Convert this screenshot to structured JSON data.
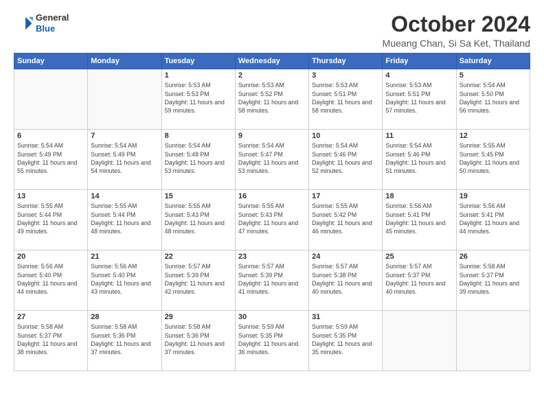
{
  "logo": {
    "line1": "General",
    "line2": "Blue"
  },
  "title": "October 2024",
  "location": "Mueang Chan, Si Sa Ket, Thailand",
  "days_of_week": [
    "Sunday",
    "Monday",
    "Tuesday",
    "Wednesday",
    "Thursday",
    "Friday",
    "Saturday"
  ],
  "weeks": [
    [
      {
        "day": "",
        "empty": true
      },
      {
        "day": "",
        "empty": true
      },
      {
        "day": "1",
        "sunrise": "5:53 AM",
        "sunset": "5:53 PM",
        "daylight": "11 hours and 59 minutes."
      },
      {
        "day": "2",
        "sunrise": "5:53 AM",
        "sunset": "5:52 PM",
        "daylight": "11 hours and 58 minutes."
      },
      {
        "day": "3",
        "sunrise": "5:53 AM",
        "sunset": "5:51 PM",
        "daylight": "11 hours and 58 minutes."
      },
      {
        "day": "4",
        "sunrise": "5:53 AM",
        "sunset": "5:51 PM",
        "daylight": "11 hours and 57 minutes."
      },
      {
        "day": "5",
        "sunrise": "5:54 AM",
        "sunset": "5:50 PM",
        "daylight": "11 hours and 56 minutes."
      }
    ],
    [
      {
        "day": "6",
        "sunrise": "5:54 AM",
        "sunset": "5:49 PM",
        "daylight": "11 hours and 55 minutes."
      },
      {
        "day": "7",
        "sunrise": "5:54 AM",
        "sunset": "5:49 PM",
        "daylight": "11 hours and 54 minutes."
      },
      {
        "day": "8",
        "sunrise": "5:54 AM",
        "sunset": "5:48 PM",
        "daylight": "11 hours and 53 minutes."
      },
      {
        "day": "9",
        "sunrise": "5:54 AM",
        "sunset": "5:47 PM",
        "daylight": "11 hours and 53 minutes."
      },
      {
        "day": "10",
        "sunrise": "5:54 AM",
        "sunset": "5:46 PM",
        "daylight": "11 hours and 52 minutes."
      },
      {
        "day": "11",
        "sunrise": "5:54 AM",
        "sunset": "5:46 PM",
        "daylight": "11 hours and 51 minutes."
      },
      {
        "day": "12",
        "sunrise": "5:55 AM",
        "sunset": "5:45 PM",
        "daylight": "11 hours and 50 minutes."
      }
    ],
    [
      {
        "day": "13",
        "sunrise": "5:55 AM",
        "sunset": "5:44 PM",
        "daylight": "11 hours and 49 minutes."
      },
      {
        "day": "14",
        "sunrise": "5:55 AM",
        "sunset": "5:44 PM",
        "daylight": "11 hours and 48 minutes."
      },
      {
        "day": "15",
        "sunrise": "5:55 AM",
        "sunset": "5:43 PM",
        "daylight": "11 hours and 48 minutes."
      },
      {
        "day": "16",
        "sunrise": "5:55 AM",
        "sunset": "5:43 PM",
        "daylight": "11 hours and 47 minutes."
      },
      {
        "day": "17",
        "sunrise": "5:55 AM",
        "sunset": "5:42 PM",
        "daylight": "11 hours and 46 minutes."
      },
      {
        "day": "18",
        "sunrise": "5:56 AM",
        "sunset": "5:41 PM",
        "daylight": "11 hours and 45 minutes."
      },
      {
        "day": "19",
        "sunrise": "5:56 AM",
        "sunset": "5:41 PM",
        "daylight": "11 hours and 44 minutes."
      }
    ],
    [
      {
        "day": "20",
        "sunrise": "5:56 AM",
        "sunset": "5:40 PM",
        "daylight": "11 hours and 44 minutes."
      },
      {
        "day": "21",
        "sunrise": "5:56 AM",
        "sunset": "5:40 PM",
        "daylight": "11 hours and 43 minutes."
      },
      {
        "day": "22",
        "sunrise": "5:57 AM",
        "sunset": "5:39 PM",
        "daylight": "11 hours and 42 minutes."
      },
      {
        "day": "23",
        "sunrise": "5:57 AM",
        "sunset": "5:39 PM",
        "daylight": "11 hours and 41 minutes."
      },
      {
        "day": "24",
        "sunrise": "5:57 AM",
        "sunset": "5:38 PM",
        "daylight": "11 hours and 40 minutes."
      },
      {
        "day": "25",
        "sunrise": "5:57 AM",
        "sunset": "5:37 PM",
        "daylight": "11 hours and 40 minutes."
      },
      {
        "day": "26",
        "sunrise": "5:58 AM",
        "sunset": "5:37 PM",
        "daylight": "11 hours and 39 minutes."
      }
    ],
    [
      {
        "day": "27",
        "sunrise": "5:58 AM",
        "sunset": "5:37 PM",
        "daylight": "11 hours and 38 minutes."
      },
      {
        "day": "28",
        "sunrise": "5:58 AM",
        "sunset": "5:36 PM",
        "daylight": "11 hours and 37 minutes."
      },
      {
        "day": "29",
        "sunrise": "5:58 AM",
        "sunset": "5:36 PM",
        "daylight": "11 hours and 37 minutes."
      },
      {
        "day": "30",
        "sunrise": "5:59 AM",
        "sunset": "5:35 PM",
        "daylight": "11 hours and 36 minutes."
      },
      {
        "day": "31",
        "sunrise": "5:59 AM",
        "sunset": "5:35 PM",
        "daylight": "11 hours and 35 minutes."
      },
      {
        "day": "",
        "empty": true
      },
      {
        "day": "",
        "empty": true
      }
    ]
  ]
}
